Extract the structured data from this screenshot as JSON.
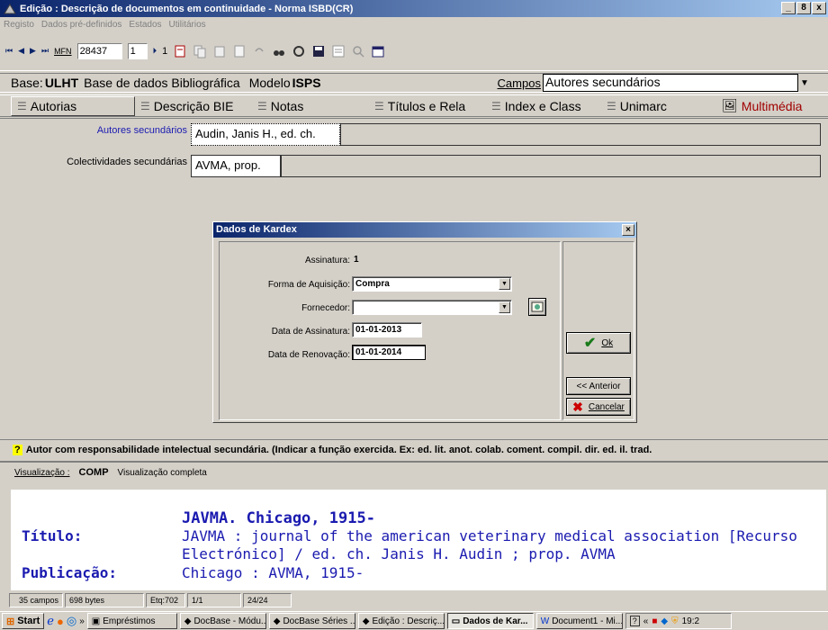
{
  "window": {
    "title": "Edição : Descrição de documentos em continuidade - Norma ISBD(CR)",
    "controls": [
      "_",
      "8",
      "x"
    ]
  },
  "menu": [
    "Registo",
    "Dados pré-definidos",
    "Estados",
    "Utilitários"
  ],
  "toolbar": {
    "mfn_label": "MFN",
    "mfn_value": "28437",
    "record_value": "1",
    "record_total": "1"
  },
  "basebar": {
    "base_label": "Base:",
    "base_code": "ULHT",
    "base_name": "Base de dados Bibliográfica",
    "modelo_label": "Modelo",
    "modelo_value": "ISPS",
    "campos_label": "Campos",
    "campos_value": "Autores secundários"
  },
  "tabs": [
    {
      "label": "Autorias"
    },
    {
      "label": "Descrição BIE"
    },
    {
      "label": "Notas"
    },
    {
      "label": "Títulos e Rela"
    },
    {
      "label": "Index e Class"
    },
    {
      "label": "Unimarc"
    },
    {
      "label": "Multimédia"
    }
  ],
  "form": {
    "autores_label": "Autores secundários",
    "autores_value": "Audin, Janis H., ed. ch.",
    "colect_label": "Colectividades secundárias",
    "colect_value": "AVMA, prop."
  },
  "dialog": {
    "title": "Dados de Kardex",
    "assinatura_label": "Assinatura:",
    "assinatura_value": "1",
    "forma_label": "Forma de Aquisição:",
    "forma_value": "Compra",
    "fornecedor_label": "Fornecedor:",
    "fornecedor_value": "",
    "data_assinatura_label": "Data de Assinatura:",
    "data_assinatura_value": "01-01-2013",
    "data_renovacao_label": "Data de Renovação:",
    "data_renovacao_value": "01-01-2014",
    "ok_label": "Ok",
    "anterior_label": "<< Anterior",
    "cancelar_label": "Cancelar"
  },
  "hint": "Autor com responsabilidade intelectual secundária. (Indicar a função exercida. Ex: ed. lit.  anot.  colab.  coment.  compil.  dir.  ed.  il.  trad.",
  "visualizacao": {
    "label": "Visualização :",
    "code": "COMP",
    "desc": "Visualização completa",
    "heading": "JAVMA. Chicago, 1915-",
    "titulo_label": "Título:",
    "titulo_value_1": "JAVMA : journal of the american veterinary medical association [Recurso",
    "titulo_value_2": "Electrónico] / ed. ch. Janis H. Audin ; prop. AVMA",
    "publicacao_label": "Publicação:",
    "publicacao_value": "Chicago : AVMA, 1915-"
  },
  "status": [
    "35 campos",
    "698 bytes",
    "Etq:702",
    "1/1",
    "24/24"
  ],
  "taskbar": {
    "start": "Start",
    "items": [
      "Empréstimos",
      "DocBase - Módu...",
      "DocBase Séries ...",
      "Edição : Descriç...",
      "Dados de Kar...",
      "Document1 - Mi..."
    ],
    "clock": "19:2"
  },
  "colors": {
    "accent_red": "#a00000",
    "link_blue": "#1a1ab0",
    "titlebar": "#0a246a"
  }
}
